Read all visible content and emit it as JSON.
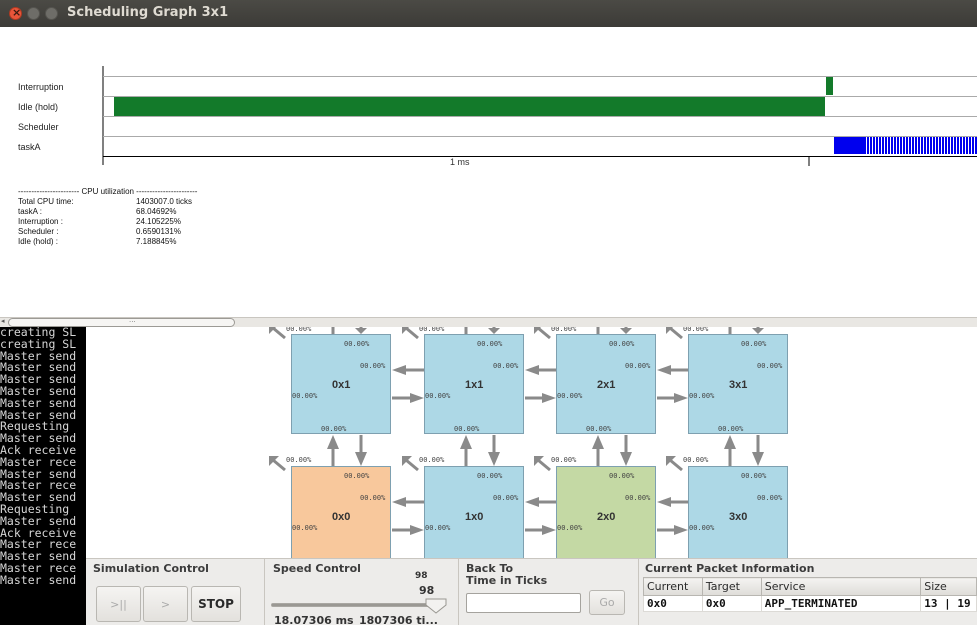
{
  "window": {
    "title": "Scheduling Graph 3x1"
  },
  "timeline": {
    "rows": [
      "Interruption",
      "Idle (hold)",
      "Scheduler",
      "taskA"
    ],
    "axis_label": "1 ms"
  },
  "cpu_utilization": {
    "header": "----------------------- CPU utilization -----------------------",
    "rows": [
      {
        "label": "Total CPU time:",
        "value": "1403007.0 ticks"
      },
      {
        "label": "taskA :",
        "value": "68.04692%"
      },
      {
        "label": "Interruption :",
        "value": "24.105225%"
      },
      {
        "label": "Scheduler :",
        "value": "0.6590131%"
      },
      {
        "label": "Idle (hold) :",
        "value": "7.188845%"
      }
    ]
  },
  "scrollbar": {
    "grip": "..."
  },
  "console": {
    "lines": [
      "creating SL",
      "creating SL",
      "Master send",
      "Master send",
      "Master send",
      "Master send",
      "Master send",
      "Master send",
      "Requesting",
      "Master send",
      "Ack receive",
      "Master rece",
      "Master send",
      "Master rece",
      "Master send",
      "Requesting",
      "Master send",
      "Ack receive",
      "Master rece",
      "Master send",
      "Master rece",
      "Master send"
    ]
  },
  "noc": {
    "pct": "00.00%",
    "tiles": [
      {
        "name": "0x1",
        "color": "#add8e6"
      },
      {
        "name": "1x1",
        "color": "#add8e6"
      },
      {
        "name": "2x1",
        "color": "#add8e6"
      },
      {
        "name": "3x1",
        "color": "#add8e6"
      },
      {
        "name": "0x0",
        "color": "#f8c89c"
      },
      {
        "name": "1x0",
        "color": "#add8e6"
      },
      {
        "name": "2x0",
        "color": "#c4d9a4"
      },
      {
        "name": "3x0",
        "color": "#add8e6"
      }
    ]
  },
  "simulation_control": {
    "title": "Simulation Control",
    "play_pause_label": ">||",
    "step_label": ">",
    "stop_label": "STOP"
  },
  "speed_control": {
    "title": "Speed Control",
    "value_top": "98",
    "value": "98",
    "slider_fraction": 0.98,
    "time_ms": "18.07306 ms",
    "time_ticks": "1807306 ti..."
  },
  "back_to": {
    "title": "Back To",
    "subtitle": "Time in Ticks",
    "input_value": "",
    "go_label": "Go"
  },
  "packet_info": {
    "title": "Current Packet Information",
    "headers": [
      "Current",
      "Target",
      "Service",
      "Size"
    ],
    "rows": [
      [
        "0x0",
        "0x0",
        "APP_TERMINATED",
        "13 | 19"
      ]
    ]
  },
  "colors": {
    "gantt_green": "#137a2a",
    "gantt_blue": "#0000ee",
    "arrow": "#8a8a8a"
  }
}
